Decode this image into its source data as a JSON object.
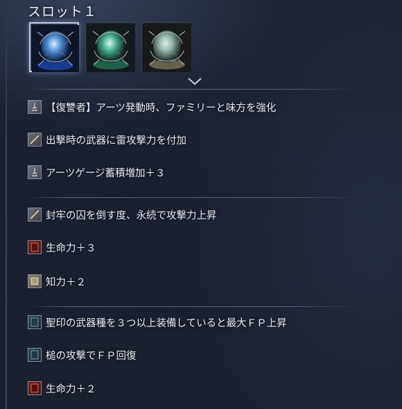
{
  "slot": {
    "title": "スロット１"
  },
  "relics": [
    {
      "name": "relic-blue",
      "selected": true,
      "color": "#4b8fd6"
    },
    {
      "name": "relic-green",
      "selected": false,
      "color": "#3fae8a"
    },
    {
      "name": "relic-tan",
      "selected": false,
      "color": "#8fb4a6"
    }
  ],
  "effect_groups": [
    {
      "effects": [
        {
          "icon": "bell-icon",
          "text": "【復讐者】アーツ発動時、ファミリーと味方を強化"
        },
        {
          "icon": "sword-icon",
          "text": "出撃時の武器に雷攻撃力を付加"
        },
        {
          "icon": "bell-icon",
          "text": "アーツゲージ蓄積増加＋３"
        }
      ]
    },
    {
      "effects": [
        {
          "icon": "sword-icon",
          "text": "封牢の囚を倒す度、永続で攻撃力上昇"
        },
        {
          "icon": "red-book-icon",
          "text": "生命力＋３"
        },
        {
          "icon": "scroll-icon",
          "text": "知力＋２"
        }
      ]
    },
    {
      "effects": [
        {
          "icon": "teal-book-icon",
          "text": "聖印の武器種を３つ以上装備していると最大ＦＰ上昇"
        },
        {
          "icon": "teal-book-icon",
          "text": "槌の攻撃でＦＰ回復"
        },
        {
          "icon": "red-book-icon",
          "text": "生命力＋２"
        }
      ]
    }
  ],
  "colors": {
    "accent": "#c9cfe2",
    "text": "#e6e8ee",
    "background": "#1a2030"
  }
}
